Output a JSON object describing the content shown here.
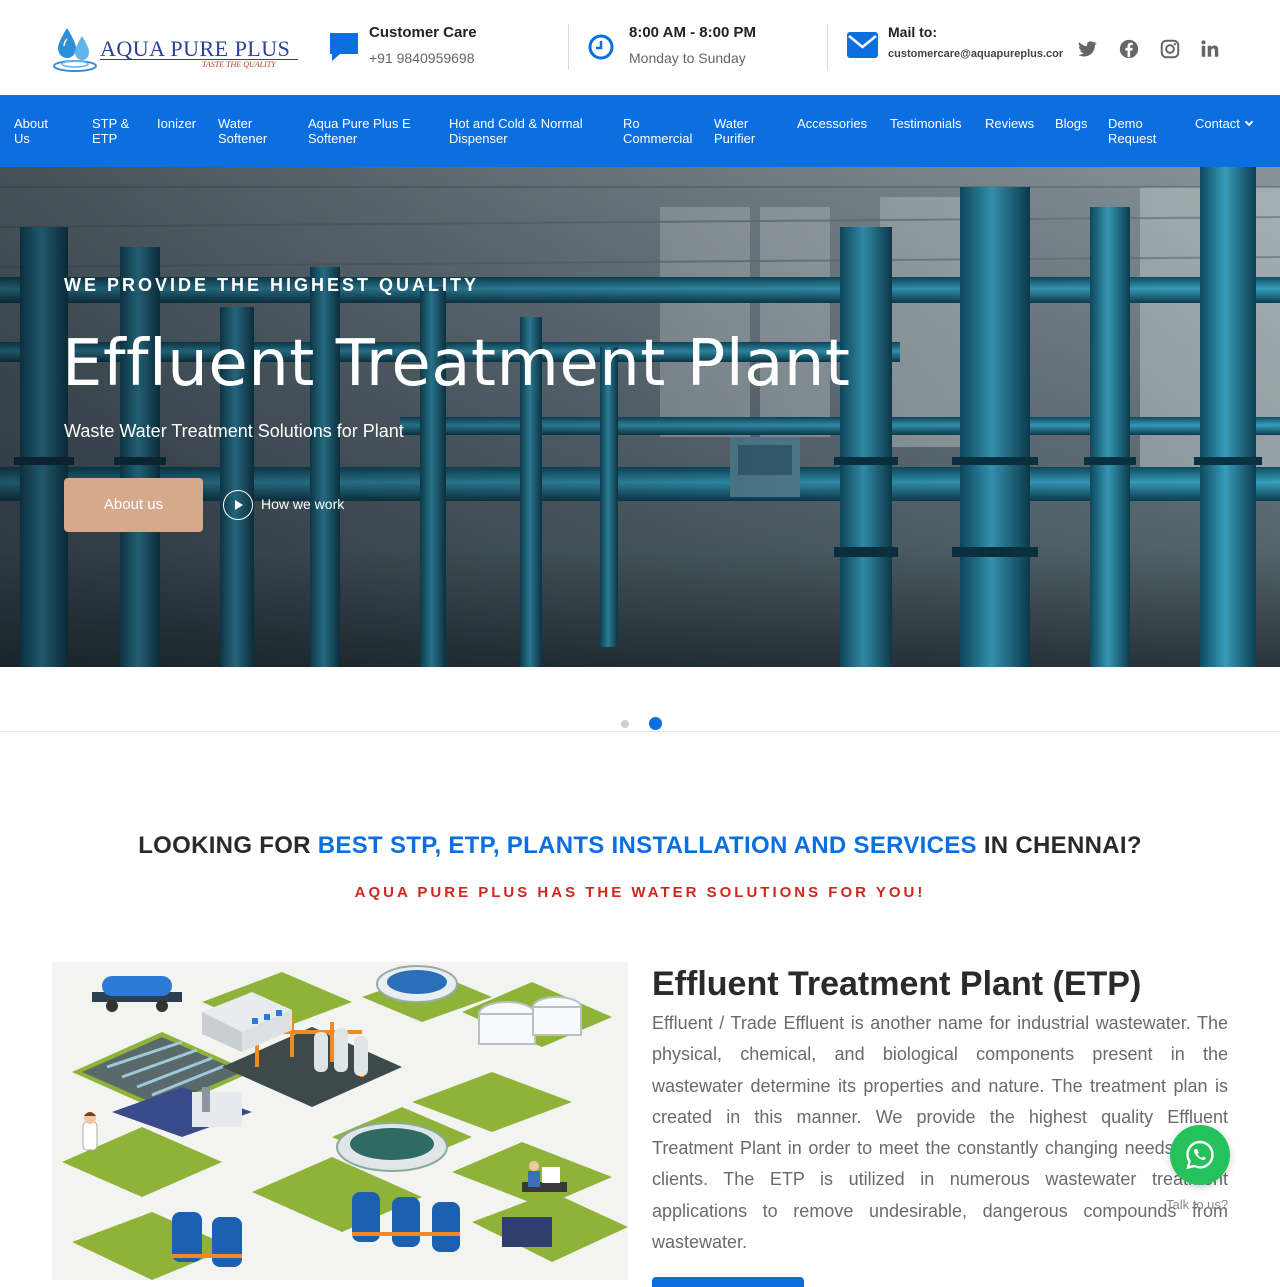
{
  "brand": {
    "name": "AQUA PURE PLUS",
    "tagline": "TASTE THE QUALITY"
  },
  "header": {
    "care_title": "Customer Care",
    "care_phone": "+91 9840959698",
    "hours_title": "8:00 AM - 8:00 PM",
    "hours_sub": "Monday to Sunday",
    "mail_title": "Mail to:",
    "mail_value": "customercare@aquapureplus.cor"
  },
  "social": [
    "twitter-icon",
    "facebook-icon",
    "instagram-icon",
    "linkedin-icon"
  ],
  "nav": {
    "items": [
      {
        "label": "About\nUs"
      },
      {
        "label": "STP &\nETP"
      },
      {
        "label": "Ionizer"
      },
      {
        "label": "Water\nSoftener"
      },
      {
        "label": "Aqua Pure Plus E\nSoftener"
      },
      {
        "label": "Hot and Cold & Normal\nDispenser"
      },
      {
        "label": "Ro\nCommercial"
      },
      {
        "label": "Water\nPurifier"
      },
      {
        "label": "Accessories"
      },
      {
        "label": "Testimonials"
      },
      {
        "label": "Reviews"
      },
      {
        "label": "Blogs"
      },
      {
        "label": "Demo\nRequest"
      },
      {
        "label": "Contact"
      }
    ]
  },
  "hero": {
    "kicker": "WE PROVIDE THE HIGHEST QUALITY",
    "title": "Effluent Treatment Plant",
    "subtitle": "Waste Water Treatment Solutions for Plant",
    "button_label": "About us",
    "video_link": "How we work",
    "slides_total": 2,
    "slide_active": 2
  },
  "intro": {
    "lead": "LOOKING FOR ",
    "highlight": "BEST STP, ETP, PLANTS INSTALLATION AND SERVICES",
    "tail": " IN CHENNAI?",
    "subline": "AQUA PURE PLUS HAS THE WATER SOLUTIONS FOR YOU!"
  },
  "etp": {
    "title": "Effluent Treatment Plant (ETP)",
    "body": "Effluent / Trade Effluent is another name for industrial wastewater. The physical, chemical, and biological components present in the wastewater determine its properties and nature. The treatment plan is created in this manner. We provide the highest quality Effluent Treatment Plant in order to meet the constantly changing needs of our clients. The ETP is utilized in numerous wastewater treatment applications to remove undesirable, dangerous compounds from wastewater."
  },
  "whatsapp": {
    "label": "Talk to us?"
  },
  "colors": {
    "primary": "#0b6fdf",
    "accent_red": "#d0261c",
    "button_tan": "#d6a98c",
    "whatsapp": "#25c25b"
  }
}
